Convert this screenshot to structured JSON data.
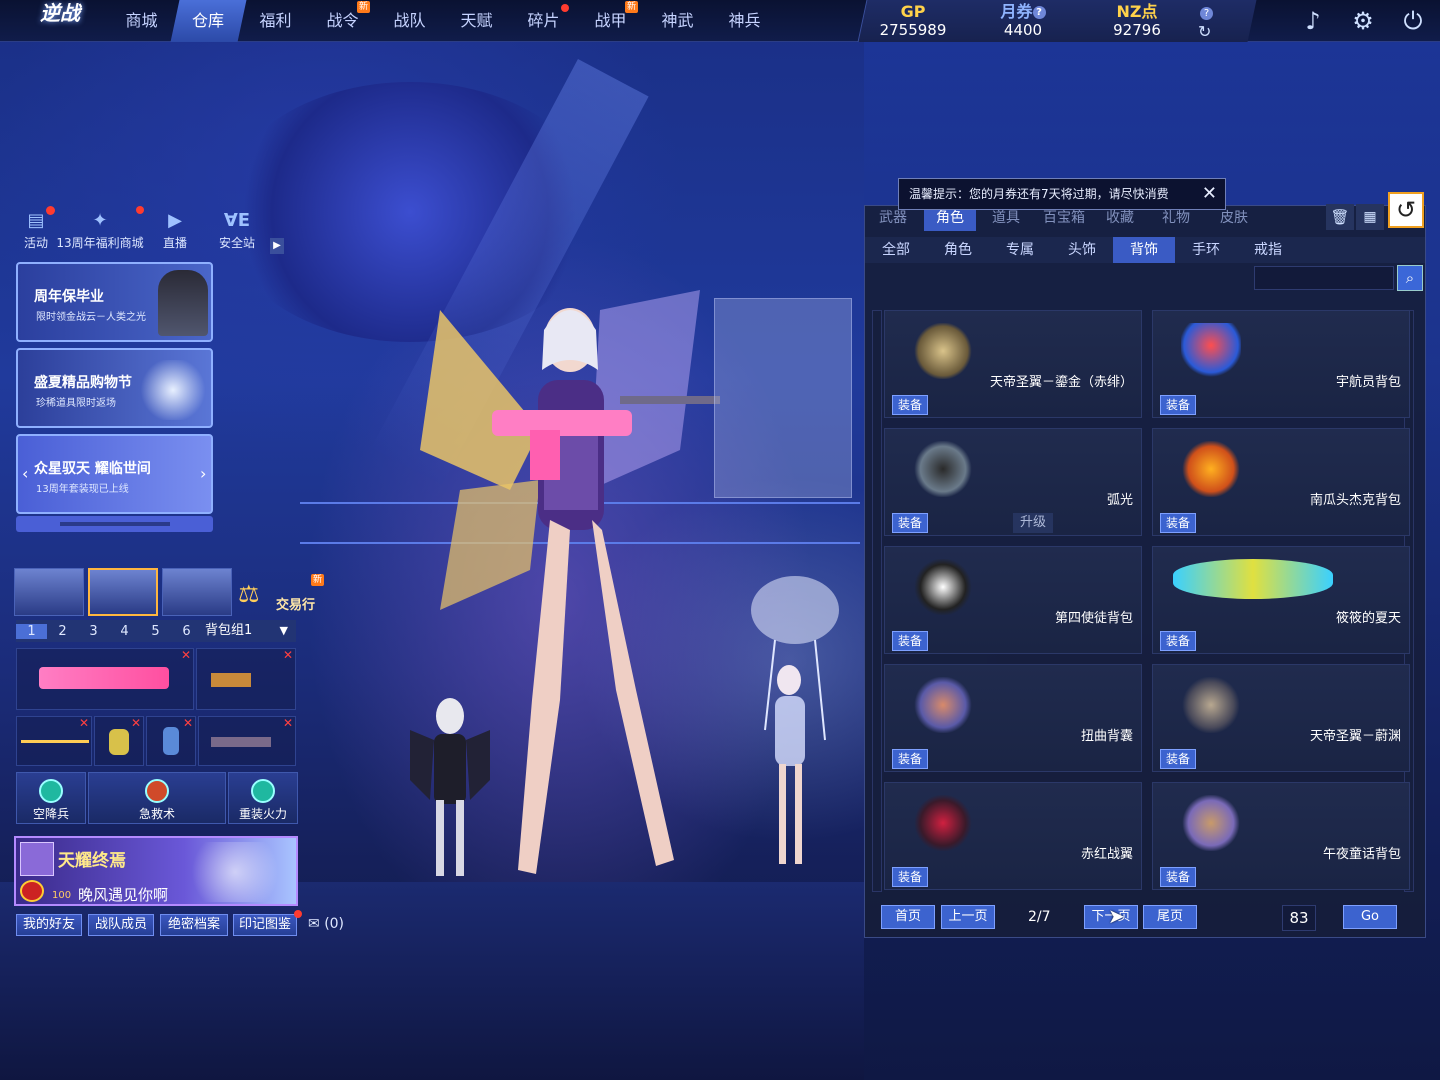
{
  "logo": "逆战",
  "nav": {
    "tabs": [
      {
        "label": "商城",
        "active": false,
        "badge": ""
      },
      {
        "label": "仓库",
        "active": true,
        "badge": ""
      },
      {
        "label": "福利",
        "active": false,
        "badge": ""
      },
      {
        "label": "战令",
        "active": false,
        "badge": "新"
      },
      {
        "label": "战队",
        "active": false,
        "badge": ""
      },
      {
        "label": "天赋",
        "active": false,
        "badge": ""
      },
      {
        "label": "碎片",
        "active": false,
        "badge": "dot"
      },
      {
        "label": "战甲",
        "active": false,
        "badge": "新"
      },
      {
        "label": "神武",
        "active": false,
        "badge": ""
      },
      {
        "label": "神兵",
        "active": false,
        "badge": ""
      }
    ]
  },
  "currency": {
    "gp_label": "GP",
    "gp_value": "2755989",
    "coupon_label": "月券",
    "coupon_value": "4400",
    "nz_label": "NZ点",
    "nz_value": "92796"
  },
  "quick_links": [
    {
      "label": "活动",
      "icon": "activity-icon"
    },
    {
      "label": "13周年福利商城",
      "icon": "anniversary-mall-icon"
    },
    {
      "label": "直播",
      "icon": "live-icon"
    },
    {
      "label": "安全站",
      "icon": "security-station-icon"
    }
  ],
  "banners": [
    {
      "title": "周年保毕业",
      "subtitle": "限时领金战云－人类之光"
    },
    {
      "title": "盛夏精品购物节",
      "subtitle": "珍稀道具限时返场"
    },
    {
      "title": "众星驭天 耀临世间",
      "subtitle": "13周年套装现已上线"
    }
  ],
  "trade": {
    "label": "交易行",
    "badge": "新"
  },
  "loadout": {
    "pages": [
      "1",
      "2",
      "3",
      "4",
      "5",
      "6"
    ],
    "active_page": "1",
    "group_label": "背包组1"
  },
  "skills": [
    {
      "label": "空降兵"
    },
    {
      "label": "急救术"
    },
    {
      "label": "重装火力"
    }
  ],
  "profile": {
    "title": "天耀终焉",
    "level": "100",
    "name": "晚风遇见你啊"
  },
  "bottom_buttons": [
    {
      "label": "我的好友"
    },
    {
      "label": "战队成员"
    },
    {
      "label": "绝密档案"
    },
    {
      "label": "印记图鉴"
    }
  ],
  "mail_count": "(0)",
  "notice": "温馨提示：您的月券还有7天将过期，请尽快消费",
  "inventory": {
    "categories": [
      {
        "label": "武器",
        "active": false
      },
      {
        "label": "角色",
        "active": true
      },
      {
        "label": "道具",
        "active": false
      },
      {
        "label": "百宝箱",
        "active": false
      },
      {
        "label": "收藏",
        "active": false
      },
      {
        "label": "礼物",
        "active": false
      },
      {
        "label": "皮肤",
        "active": false
      }
    ],
    "subtabs": [
      {
        "label": "全部",
        "active": false
      },
      {
        "label": "角色",
        "active": false
      },
      {
        "label": "专属",
        "active": false
      },
      {
        "label": "头饰",
        "active": false
      },
      {
        "label": "背饰",
        "active": true
      },
      {
        "label": "手环",
        "active": false
      },
      {
        "label": "戒指",
        "active": false
      }
    ],
    "search_placeholder": "",
    "equip_label": "装备",
    "upgrade_label": "升级",
    "items": [
      {
        "name": "天帝圣翼－鎏金（赤绯）",
        "icon": "golden-wings-icon",
        "upgrade": false
      },
      {
        "name": "宇航员背包",
        "icon": "astronaut-backpack-icon",
        "upgrade": false
      },
      {
        "name": "弧光",
        "icon": "arc-mech-wings-icon",
        "upgrade": true
      },
      {
        "name": "南瓜头杰克背包",
        "icon": "pumpkin-backpack-icon",
        "upgrade": false
      },
      {
        "name": "第四使徒背包",
        "icon": "apostle-backpack-icon",
        "upgrade": false
      },
      {
        "name": "筱筱的夏天",
        "icon": "surfboard-icon",
        "upgrade": false
      },
      {
        "name": "扭曲背囊",
        "icon": "twisted-pack-icon",
        "upgrade": false
      },
      {
        "name": "天帝圣翼－蔚渊",
        "icon": "azure-wings-icon",
        "upgrade": false
      },
      {
        "name": "赤红战翼",
        "icon": "crimson-wings-icon",
        "upgrade": false
      },
      {
        "name": "午夜童话背包",
        "icon": "teddy-bear-backpack-icon",
        "upgrade": false
      }
    ],
    "pagination": {
      "first": "首页",
      "prev": "上一页",
      "current": "2/7",
      "next": "下一页",
      "last": "尾页",
      "input": "83",
      "go": "Go"
    }
  },
  "colors": {
    "accent": "#3c63cf",
    "gold": "#ffd24a",
    "badge": "#ff7a1a",
    "alert": "#ff3b2f"
  }
}
